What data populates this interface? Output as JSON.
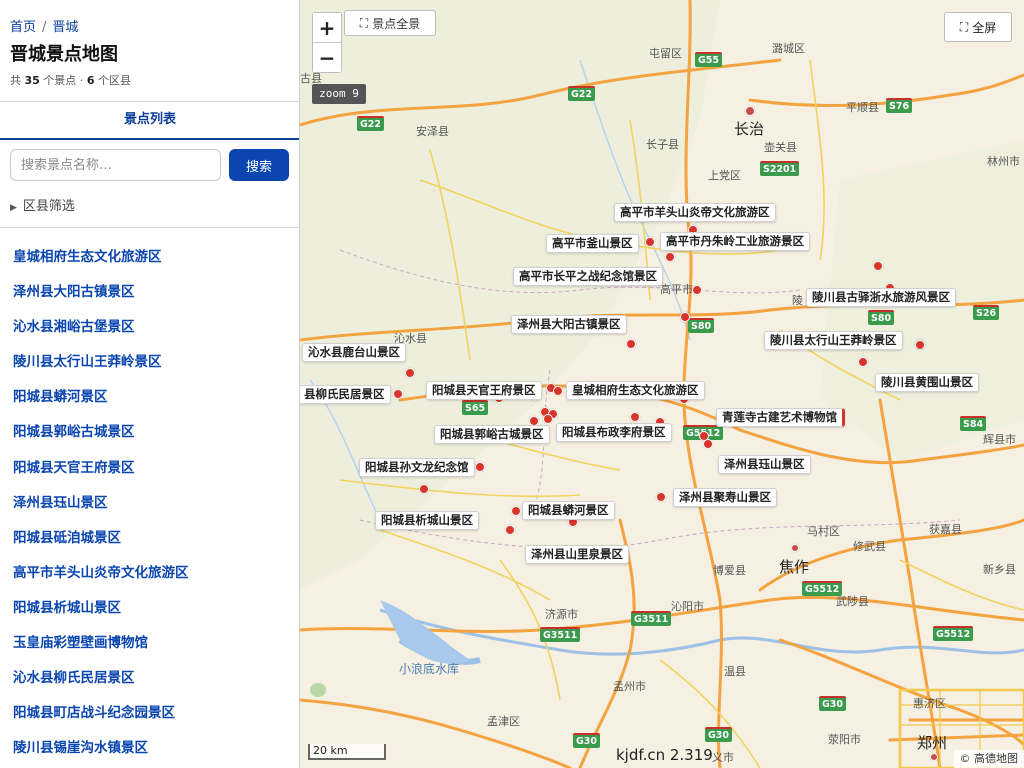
{
  "breadcrumb": {
    "home": "首页",
    "separator": "/",
    "current": "晋城"
  },
  "page": {
    "title": "晋城景点地图",
    "stats_prefix": "共",
    "spot_count": "35",
    "spot_unit": "个景点 ·",
    "district_count": "6",
    "district_unit": "个区县"
  },
  "tab": {
    "label": "景点列表"
  },
  "search": {
    "placeholder": "搜索景点名称…",
    "button": "搜索"
  },
  "filter": {
    "label": "区县筛选"
  },
  "spots": [
    "皇城相府生态文化旅游区",
    "泽州县大阳古镇景区",
    "沁水县湘峪古堡景区",
    "陵川县太行山王莽岭景区",
    "阳城县蟒河景区",
    "阳城县郭峪古城景区",
    "阳城县天官王府景区",
    "泽州县珏山景区",
    "阳城县砥洎城景区",
    "高平市羊头山炎帝文化旅游区",
    "阳城县析城山景区",
    "玉皇庙彩塑壁画博物馆",
    "沁水县柳氏民居景区",
    "阳城县町店战斗纪念园景区",
    "陵川县锡崖沟水镇景区"
  ],
  "map": {
    "zoom_in": "+",
    "zoom_out": "−",
    "overview": "景点全景",
    "fullscreen": "全屏",
    "zoom_label": "zoom 9",
    "scale": "20 km",
    "watermark": "kjdf.cn 2.319",
    "attribution": "© 高德地图",
    "poi_labels": [
      "高平市羊头山炎帝文化旅游区",
      "高平市釜山景区",
      "高平市丹朱岭工业旅游景区",
      "高平市长平之战纪念馆景区",
      "泽州县大阳古镇景区",
      "陵川县古驿浙水旅游风景区",
      "陵川县太行山王莽岭景区",
      "沁水县鹿台山景区",
      "陵川县黄围山景区",
      "县柳氏民居景区",
      "阳城县天官王府景区",
      "皇城相府生态文化旅游区",
      "青莲寺古建艺术博物馆",
      "阳城县郭峪古城景区",
      "阳城县布政李府景区",
      "阳城县孙文龙纪念馆",
      "泽州县珏山景区",
      "泽州县聚寿山景区",
      "阳城县蟒河景区",
      "阳城县析城山景区",
      "泽州县山里泉景区"
    ],
    "towns": [
      "屯留区",
      "潞城区",
      "古县",
      "安泽县",
      "长子县",
      "壶关县",
      "平顺县",
      "上党区",
      "林州市",
      "长治",
      "沁水县",
      "高平市",
      "陵",
      "辉县市",
      "马村区",
      "修武县",
      "获嘉县",
      "焦作",
      "博爱县",
      "武陟县",
      "新乡县",
      "济源市",
      "沁阳市",
      "小浪底水库",
      "温县",
      "孟州市",
      "孟津区",
      "荥阳市",
      "惠济区",
      "郑州",
      "义市"
    ],
    "highways": [
      "G55",
      "G22",
      "S76",
      "S2201",
      "G22",
      "S80",
      "S80",
      "S26",
      "S65",
      "G5512",
      "S84",
      "G5512",
      "G3511",
      "G3511",
      "G5512",
      "G30",
      "G30",
      "G30"
    ]
  }
}
